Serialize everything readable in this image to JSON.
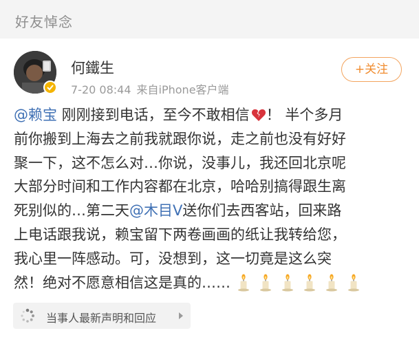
{
  "section": {
    "title": "好友悼念"
  },
  "post": {
    "author": "何鐵生",
    "time": "7-20 08:44",
    "source_prefix": "来自",
    "source": "iPhone客户端",
    "follow_label": "+关注",
    "mention_1": "@赖宝",
    "text_1_after": " 刚刚接到电话，至今不敢相信",
    "text_1_end": "！ 半个多月",
    "line_2": "前你搬到上海去之前我就跟你说，走之前也没有好好",
    "line_3": "聚一下，这不怎么对…你说，没事儿，我还回北京呢",
    "line_4": "大部分时间和工作内容都在北京，哈哈别搞得跟生离",
    "line_5_before": "死别似的…第二天",
    "mention_2": "@木目V",
    "line_5_after": "送你们去西客站，回来路",
    "line_6": "上电话跟我说，赖宝留下两卷画画的纸让我转给您，",
    "line_7": "我心里一阵感动。可，没想到，这一切竟是这么突",
    "line_8": "然！绝对不愿意相信这是真的……"
  },
  "related": {
    "label": "当事人最新声明和回应"
  },
  "icons": {
    "broken_heart": "broken-heart-icon",
    "candle": "candle-icon",
    "verified": "verified-badge-icon",
    "spinner": "spinner-icon",
    "chevron": "chevron-right-icon"
  },
  "colors": {
    "mention": "#3f70b4",
    "follow_orange": "#f08b2d",
    "verified_gold": "#f4b400",
    "header_bg": "#f4f4f4"
  }
}
